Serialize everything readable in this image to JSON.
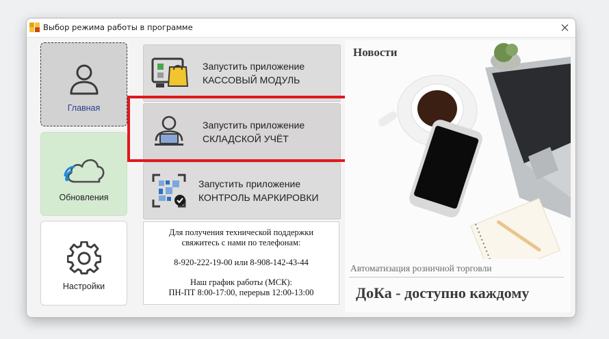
{
  "window": {
    "title": "Выбор режима работы в программе",
    "close_label": "✕"
  },
  "nav": {
    "home_label": "Главная",
    "updates_label": "Обновления",
    "settings_label": "Настройки"
  },
  "apps": {
    "cashier": {
      "line1": "Запустить приложение",
      "line2": "КАССОВЫЙ МОДУЛЬ"
    },
    "warehouse": {
      "line1": "Запустить приложение",
      "line2": "СКЛАДСКОЙ УЧЁТ"
    },
    "marking": {
      "line1": "Запустить приложение",
      "line2": "КОНТРОЛЬ МАРКИРОВКИ"
    }
  },
  "support": {
    "line1": "Для получения технической поддержки",
    "line2": "свяжитесь с нами по телефонам:",
    "phones": "8-920-222-19-00 или 8-908-142-43-44",
    "schedule_title": "Наш график работы (МСК):",
    "schedule": "ПН-ПТ 8:00-17:00, перерыв 12:00-13:00"
  },
  "news": {
    "title": "Новости",
    "tagline": "Автоматизация розничной торговли",
    "slogan": "ДоКа - доступно каждому"
  },
  "colors": {
    "highlight": "#e0181d",
    "home_bg": "#d2d2d2",
    "updates_bg": "#d4ebd2",
    "accent_text": "#2a3f8f"
  }
}
